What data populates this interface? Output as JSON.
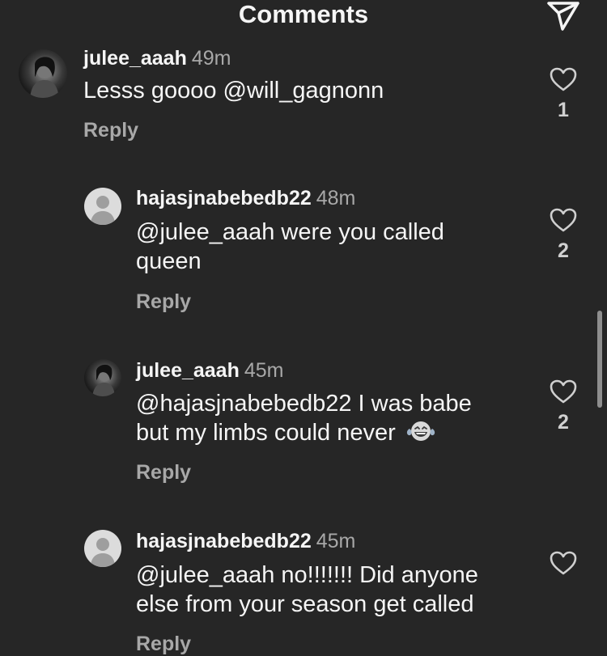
{
  "header": {
    "title": "Comments",
    "send_icon": "send-icon"
  },
  "comments": [
    {
      "username": "julee_aaah",
      "time": "49m",
      "text": "Lesss goooo @will_gagnonn",
      "reply_label": "Reply",
      "likes": "1",
      "avatar": "profile-photo"
    },
    {
      "username": "hajasjnabebedb22",
      "time": "48m",
      "text_line1": "@julee_aaah were you called",
      "text_line2": "queen",
      "reply_label": "Reply",
      "likes": "2",
      "avatar": "default-avatar"
    },
    {
      "username": "julee_aaah",
      "time": "45m",
      "text_line1": "@hajasjnabebedb22 I was babe",
      "text_line2": "but my limbs could never",
      "emoji": "laughing-crying-emoji",
      "reply_label": "Reply",
      "likes": "2",
      "avatar": "profile-photo"
    },
    {
      "username": "hajasjnabebedb22",
      "time": "45m",
      "text_line1": "@julee_aaah no!!!!!!! Did anyone",
      "text_line2": "else from your season get called",
      "reply_label": "Reply",
      "avatar": "default-avatar"
    }
  ],
  "colors": {
    "background": "#262626",
    "primary_text": "#f5f5f5",
    "secondary_text": "#a8a8a8"
  }
}
